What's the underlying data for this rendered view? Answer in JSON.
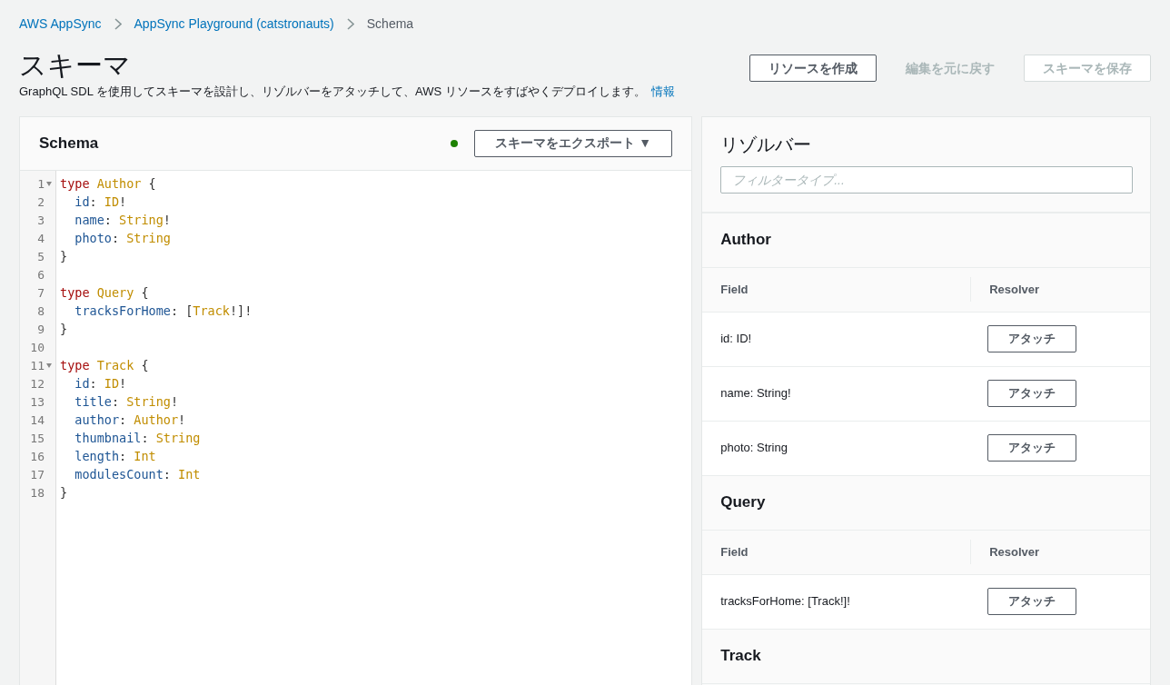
{
  "breadcrumbs": [
    {
      "label": "AWS AppSync",
      "link": true
    },
    {
      "label": "AppSync Playground (catstronauts)",
      "link": true
    },
    {
      "label": "Schema",
      "link": false
    }
  ],
  "page": {
    "title": "スキーマ",
    "description": "GraphQL SDL を使用してスキーマを設計し、リゾルバーをアタッチして、AWS リソースをすばやくデプロイします。",
    "info_link": "情報"
  },
  "actions": [
    {
      "label": "リソースを作成",
      "kind": "outline",
      "disabled": false
    },
    {
      "label": "編集を元に戻す",
      "kind": "link",
      "disabled": true
    },
    {
      "label": "スキーマを保存",
      "kind": "outline",
      "disabled": true
    }
  ],
  "editor": {
    "title": "Schema",
    "export_button": "スキーマをエクスポート ▼",
    "lines": [
      {
        "number": "1",
        "fold": true,
        "tokens": [
          {
            "kind": "keyword",
            "text": "type "
          },
          {
            "kind": "type",
            "text": "Author"
          },
          {
            "kind": "punct",
            "text": " {"
          }
        ]
      },
      {
        "number": "2",
        "tokens": [
          {
            "kind": "field",
            "text": "  id"
          },
          {
            "kind": "punct",
            "text": ": "
          },
          {
            "kind": "type",
            "text": "ID"
          },
          {
            "kind": "punct",
            "text": "!"
          }
        ]
      },
      {
        "number": "3",
        "tokens": [
          {
            "kind": "field",
            "text": "  name"
          },
          {
            "kind": "punct",
            "text": ": "
          },
          {
            "kind": "type",
            "text": "String"
          },
          {
            "kind": "punct",
            "text": "!"
          }
        ]
      },
      {
        "number": "4",
        "tokens": [
          {
            "kind": "field",
            "text": "  photo"
          },
          {
            "kind": "punct",
            "text": ": "
          },
          {
            "kind": "type",
            "text": "String"
          }
        ]
      },
      {
        "number": "5",
        "tokens": [
          {
            "kind": "punct",
            "text": "}"
          }
        ]
      },
      {
        "number": "6"
      },
      {
        "number": "7",
        "tokens": [
          {
            "kind": "keyword",
            "text": "type "
          },
          {
            "kind": "type",
            "text": "Query"
          },
          {
            "kind": "punct",
            "text": " {"
          }
        ]
      },
      {
        "number": "8",
        "tokens": [
          {
            "kind": "field",
            "text": "  tracksForHome"
          },
          {
            "kind": "punct",
            "text": ": ["
          },
          {
            "kind": "type",
            "text": "Track"
          },
          {
            "kind": "punct",
            "text": "!]!"
          }
        ]
      },
      {
        "number": "9",
        "tokens": [
          {
            "kind": "punct",
            "text": "}"
          }
        ]
      },
      {
        "number": "10"
      },
      {
        "number": "11",
        "fold": true,
        "tokens": [
          {
            "kind": "keyword",
            "text": "type "
          },
          {
            "kind": "type",
            "text": "Track"
          },
          {
            "kind": "punct",
            "text": " {"
          }
        ]
      },
      {
        "number": "12",
        "tokens": [
          {
            "kind": "field",
            "text": "  id"
          },
          {
            "kind": "punct",
            "text": ": "
          },
          {
            "kind": "type",
            "text": "ID"
          },
          {
            "kind": "punct",
            "text": "!"
          }
        ]
      },
      {
        "number": "13",
        "tokens": [
          {
            "kind": "field",
            "text": "  title"
          },
          {
            "kind": "punct",
            "text": ": "
          },
          {
            "kind": "type",
            "text": "String"
          },
          {
            "kind": "punct",
            "text": "!"
          }
        ]
      },
      {
        "number": "14",
        "tokens": [
          {
            "kind": "field",
            "text": "  author"
          },
          {
            "kind": "punct",
            "text": ": "
          },
          {
            "kind": "type",
            "text": "Author"
          },
          {
            "kind": "punct",
            "text": "!"
          }
        ]
      },
      {
        "number": "15",
        "tokens": [
          {
            "kind": "field",
            "text": "  thumbnail"
          },
          {
            "kind": "punct",
            "text": ": "
          },
          {
            "kind": "type",
            "text": "String"
          }
        ]
      },
      {
        "number": "16",
        "tokens": [
          {
            "kind": "field",
            "text": "  length"
          },
          {
            "kind": "punct",
            "text": ": "
          },
          {
            "kind": "type",
            "text": "Int"
          }
        ]
      },
      {
        "number": "17",
        "tokens": [
          {
            "kind": "field",
            "text": "  modulesCount"
          },
          {
            "kind": "punct",
            "text": ": "
          },
          {
            "kind": "type",
            "text": "Int"
          }
        ]
      },
      {
        "number": "18",
        "tokens": [
          {
            "kind": "punct",
            "text": "}"
          }
        ]
      }
    ]
  },
  "resolvers": {
    "title": "リゾルバー",
    "filter_placeholder": "フィルタータイプ...",
    "sections": [
      {
        "type": "Author",
        "columns": [
          "Field",
          "Resolver"
        ],
        "rows": [
          {
            "field": "id: ID!",
            "action": "アタッチ"
          },
          {
            "field": "name: String!",
            "action": "アタッチ"
          },
          {
            "field": "photo: String",
            "action": "アタッチ"
          }
        ]
      },
      {
        "type": "Query",
        "columns": [
          "Field",
          "Resolver"
        ],
        "rows": [
          {
            "field": "tracksForHome: [Track!]!",
            "action": "アタッチ"
          }
        ]
      },
      {
        "type": "Track"
      }
    ]
  }
}
